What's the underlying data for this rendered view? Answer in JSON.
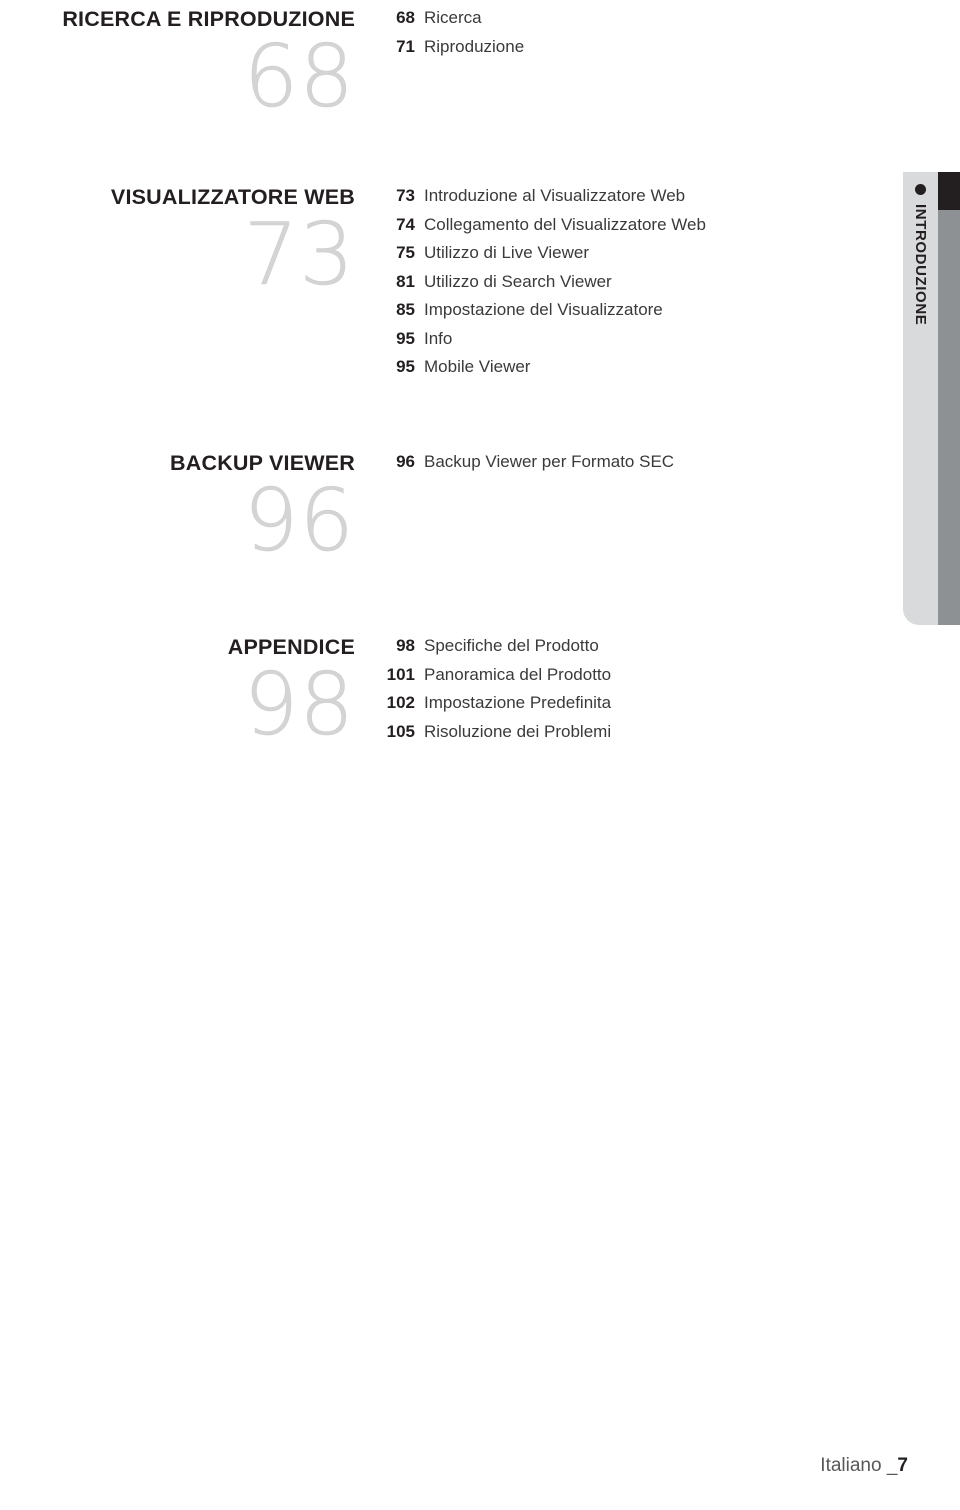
{
  "document": {
    "type": "table-of-contents",
    "language": "Italiano"
  },
  "sections": [
    {
      "title": "RICERCA E RIPRODUZIONE",
      "big_number": "68",
      "entries": [
        {
          "page": "68",
          "label": "Ricerca"
        },
        {
          "page": "71",
          "label": "Riproduzione"
        }
      ]
    },
    {
      "title": "VISUALIZZATORE WEB",
      "big_number": "73",
      "entries": [
        {
          "page": "73",
          "label": "Introduzione al Visualizzatore Web"
        },
        {
          "page": "74",
          "label": "Collegamento del Visualizzatore Web"
        },
        {
          "page": "75",
          "label": "Utilizzo di Live Viewer"
        },
        {
          "page": "81",
          "label": "Utilizzo di Search Viewer"
        },
        {
          "page": "85",
          "label": "Impostazione del Visualizzatore"
        },
        {
          "page": "95",
          "label": "Info"
        },
        {
          "page": "95",
          "label": "Mobile Viewer"
        }
      ]
    },
    {
      "title": "BACKUP VIEWER",
      "big_number": "96",
      "entries": [
        {
          "page": "96",
          "label": "Backup Viewer per Formato SEC"
        }
      ]
    },
    {
      "title": "APPENDICE",
      "big_number": "98",
      "entries": [
        {
          "page": "98",
          "label": "Specifiche del Prodotto"
        },
        {
          "page": "101",
          "label": "Panoramica del Prodotto"
        },
        {
          "page": "102",
          "label": "Impostazione Predefinita"
        },
        {
          "page": "105",
          "label": "Risoluzione dei Problemi"
        }
      ]
    }
  ],
  "side_tab": {
    "label": "INTRODUZIONE",
    "marker_icon": "bullet-dot-icon",
    "light_color": "#d9dadb",
    "gray_color": "#8e9194",
    "dark_color": "#231f20"
  },
  "footer": {
    "language": "Italiano _",
    "page_number": "7"
  }
}
